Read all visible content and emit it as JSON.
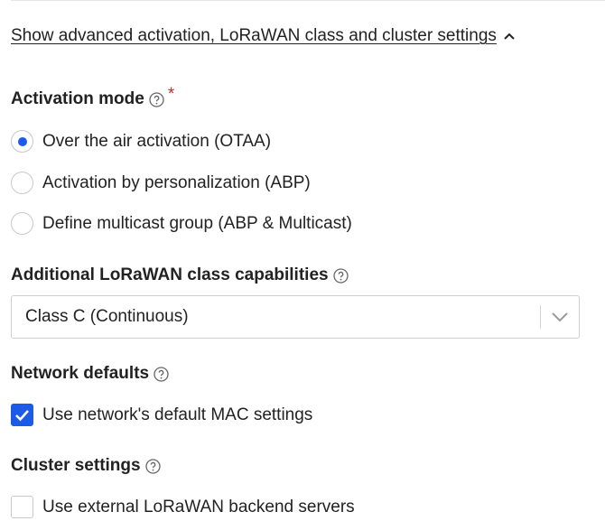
{
  "advanced_toggle": {
    "label": "Show advanced activation, LoRaWAN class and cluster settings"
  },
  "activation_mode": {
    "label": "Activation mode",
    "required_mark": "*",
    "options": [
      {
        "label": "Over the air activation (OTAA)",
        "checked": true
      },
      {
        "label": "Activation by personalization (ABP)",
        "checked": false
      },
      {
        "label": "Define multicast group (ABP & Multicast)",
        "checked": false
      }
    ]
  },
  "class_capabilities": {
    "label": "Additional LoRaWAN class capabilities",
    "selected": "Class C (Continuous)"
  },
  "network_defaults": {
    "label": "Network defaults",
    "checkbox_label": "Use network's default MAC settings",
    "checked": true
  },
  "cluster_settings": {
    "label": "Cluster settings",
    "checkbox_label": "Use external LoRaWAN backend servers",
    "checked": false
  },
  "colors": {
    "accent": "#1c5ae8",
    "required": "#db2424",
    "text": "#222222",
    "border": "#cfcfcf"
  },
  "icons": {
    "toggle": "chevron-up-icon",
    "help": "help-circle-icon",
    "select": "chevron-down-icon",
    "check": "checkmark-icon"
  }
}
